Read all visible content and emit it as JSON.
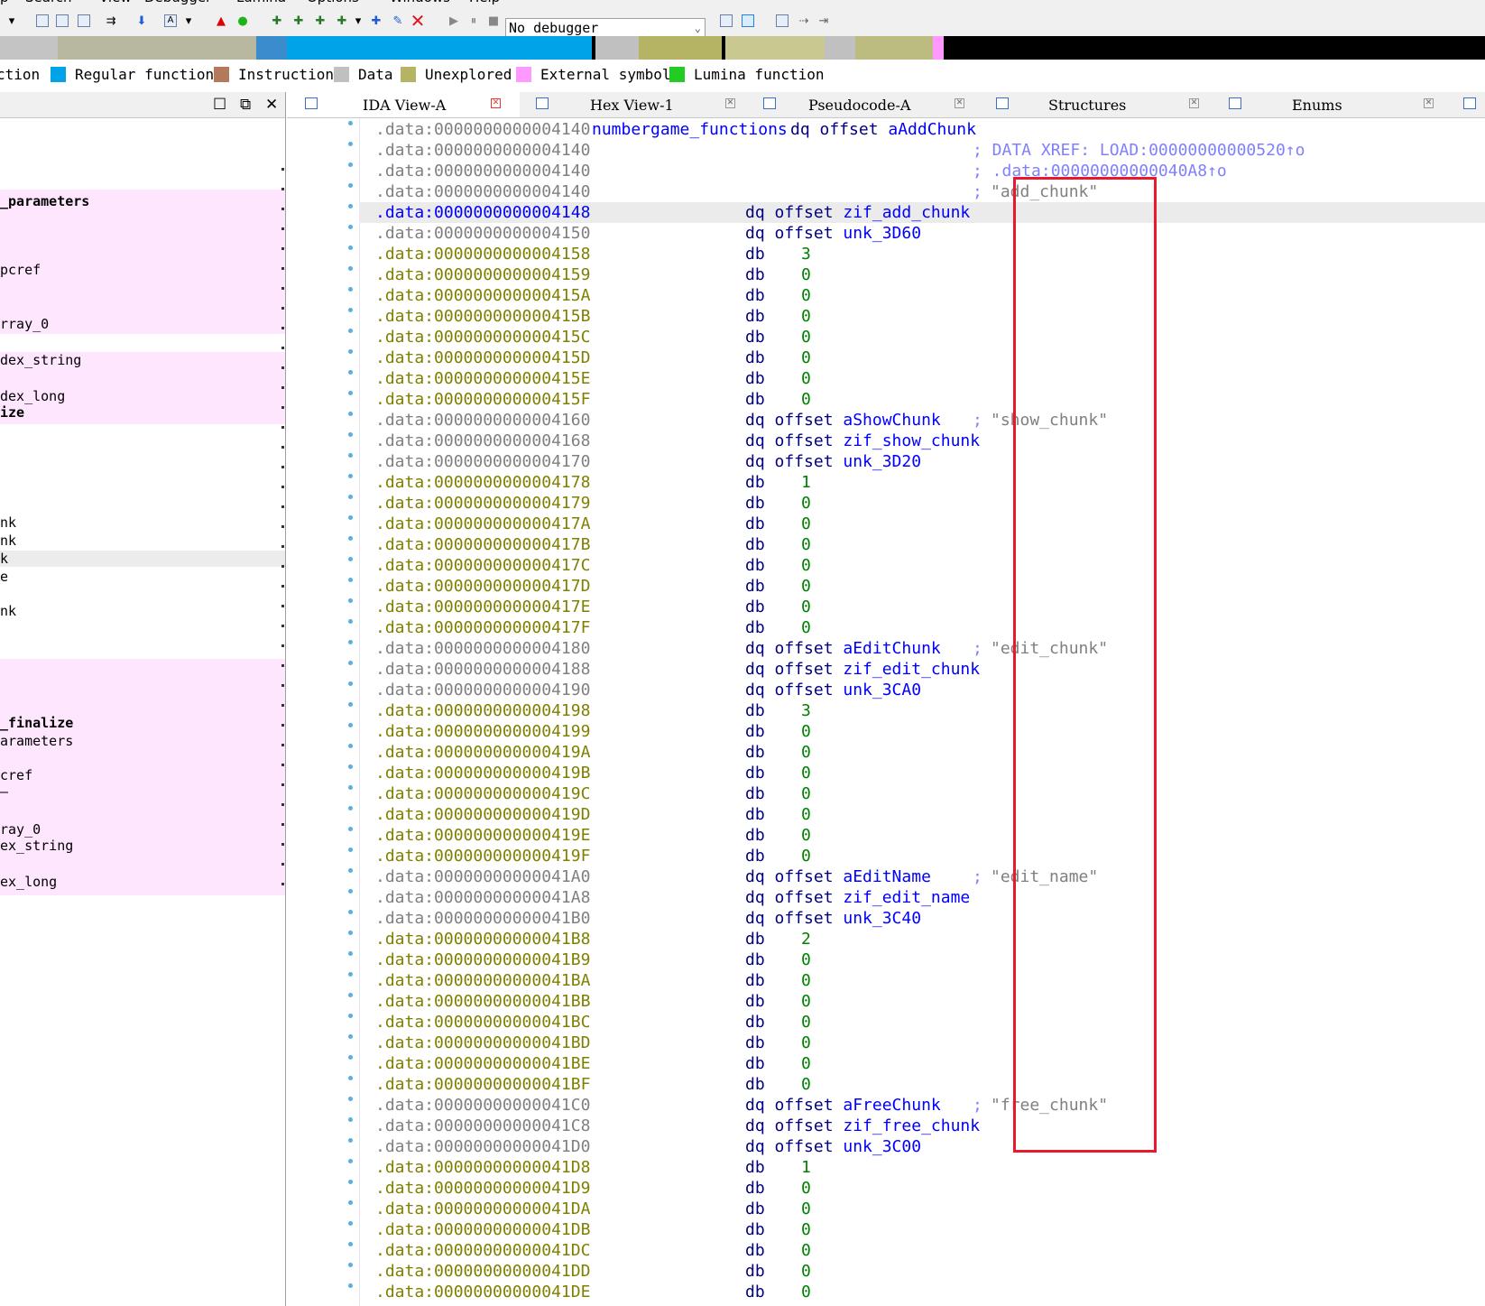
{
  "menu": [
    "p",
    "Search",
    "View",
    "Debugger",
    "Lumina",
    "Options",
    "Windows",
    "Help"
  ],
  "toolbar": {
    "debugger": "No debugger",
    "icons": [
      "dropdown-icon",
      "jump-icon",
      "jump-icon",
      "jump-icon",
      "forward-icon",
      "down-arrow-icon",
      "text-icon",
      "chart-icon",
      "green-dot-icon",
      "add-icon",
      "add-icon",
      "add-icon",
      "add-icon",
      "dropdown-icon",
      "add-icon",
      "edit-icon",
      "close-icon",
      "play-icon",
      "pause-icon",
      "stop-icon",
      "debugger-dropdown",
      "attach-icon",
      "step-icon",
      "graph-icon",
      "step-into-icon",
      "step-over-icon"
    ]
  },
  "legend": [
    {
      "label": "ction",
      "color": ""
    },
    {
      "label": "Regular function",
      "color": "#00a2e8"
    },
    {
      "label": "Instruction",
      "color": "#b4785a"
    },
    {
      "label": "Data",
      "color": "#c0c0c0"
    },
    {
      "label": "Unexplored",
      "color": "#b4b464"
    },
    {
      "label": "External symbol",
      "color": "#ff99ff"
    },
    {
      "label": "Lumina function",
      "color": "#22cc22"
    }
  ],
  "left_panel": {
    "items": [
      "_parameters",
      "pcref",
      "rray_0",
      "dex_string",
      "dex_long",
      "ize",
      "nk",
      "nk",
      "k",
      "e",
      "nk",
      "_finalize",
      "arameters",
      "cref",
      "—",
      "ray_0",
      "ex_string",
      "ex_long"
    ]
  },
  "tabs": [
    {
      "label": "IDA View-A",
      "active": true
    },
    {
      "label": "Hex View-1",
      "active": false
    },
    {
      "label": "Pseudocode-A",
      "active": false
    },
    {
      "label": "Structures",
      "active": false
    },
    {
      "label": "Enums",
      "active": false
    }
  ],
  "listing": [
    {
      "addr": ".data:0000000000004140",
      "c": "g",
      "label": "numbergame_functions",
      "op": "dq offset aAddChunk",
      "cmt": "",
      "str": ""
    },
    {
      "addr": ".data:0000000000004140",
      "c": "g",
      "label": "",
      "op": "",
      "cmt": "; DATA XREF: LOAD:00000000000520↑o",
      "str": ""
    },
    {
      "addr": ".data:0000000000004140",
      "c": "g",
      "label": "",
      "op": "",
      "cmt": "; .data:00000000000040A8↑o",
      "str": ""
    },
    {
      "addr": ".data:0000000000004140",
      "c": "g",
      "label": "",
      "op": "",
      "cmt": ";",
      "str": "\"add_chunk\""
    },
    {
      "addr": ".data:0000000000004148",
      "c": "b",
      "label": "",
      "op": "dq offset zif_add_chunk",
      "cmt": "",
      "str": ""
    },
    {
      "addr": ".data:0000000000004150",
      "c": "g",
      "label": "",
      "op": "dq offset unk_3D60",
      "cmt": "",
      "str": ""
    },
    {
      "addr": ".data:0000000000004158",
      "c": "y",
      "label": "",
      "op": "db",
      "val": "3"
    },
    {
      "addr": ".data:0000000000004159",
      "c": "y",
      "label": "",
      "op": "db",
      "val": "0"
    },
    {
      "addr": ".data:000000000000415A",
      "c": "y",
      "label": "",
      "op": "db",
      "val": "0"
    },
    {
      "addr": ".data:000000000000415B",
      "c": "y",
      "label": "",
      "op": "db",
      "val": "0"
    },
    {
      "addr": ".data:000000000000415C",
      "c": "y",
      "label": "",
      "op": "db",
      "val": "0"
    },
    {
      "addr": ".data:000000000000415D",
      "c": "y",
      "label": "",
      "op": "db",
      "val": "0"
    },
    {
      "addr": ".data:000000000000415E",
      "c": "y",
      "label": "",
      "op": "db",
      "val": "0"
    },
    {
      "addr": ".data:000000000000415F",
      "c": "y",
      "label": "",
      "op": "db",
      "val": "0"
    },
    {
      "addr": ".data:0000000000004160",
      "c": "g",
      "label": "",
      "op": "dq offset aShowChunk",
      "cmt": ";",
      "str": "\"show_chunk\""
    },
    {
      "addr": ".data:0000000000004168",
      "c": "g",
      "label": "",
      "op": "dq offset zif_show_chunk",
      "cmt": "",
      "str": ""
    },
    {
      "addr": ".data:0000000000004170",
      "c": "g",
      "label": "",
      "op": "dq offset unk_3D20",
      "cmt": "",
      "str": ""
    },
    {
      "addr": ".data:0000000000004178",
      "c": "y",
      "label": "",
      "op": "db",
      "val": "1"
    },
    {
      "addr": ".data:0000000000004179",
      "c": "y",
      "label": "",
      "op": "db",
      "val": "0"
    },
    {
      "addr": ".data:000000000000417A",
      "c": "y",
      "label": "",
      "op": "db",
      "val": "0"
    },
    {
      "addr": ".data:000000000000417B",
      "c": "y",
      "label": "",
      "op": "db",
      "val": "0"
    },
    {
      "addr": ".data:000000000000417C",
      "c": "y",
      "label": "",
      "op": "db",
      "val": "0"
    },
    {
      "addr": ".data:000000000000417D",
      "c": "y",
      "label": "",
      "op": "db",
      "val": "0"
    },
    {
      "addr": ".data:000000000000417E",
      "c": "y",
      "label": "",
      "op": "db",
      "val": "0"
    },
    {
      "addr": ".data:000000000000417F",
      "c": "y",
      "label": "",
      "op": "db",
      "val": "0"
    },
    {
      "addr": ".data:0000000000004180",
      "c": "g",
      "label": "",
      "op": "dq offset aEditChunk",
      "cmt": ";",
      "str": "\"edit_chunk\""
    },
    {
      "addr": ".data:0000000000004188",
      "c": "g",
      "label": "",
      "op": "dq offset zif_edit_chunk",
      "cmt": "",
      "str": ""
    },
    {
      "addr": ".data:0000000000004190",
      "c": "g",
      "label": "",
      "op": "dq offset unk_3CA0",
      "cmt": "",
      "str": ""
    },
    {
      "addr": ".data:0000000000004198",
      "c": "y",
      "label": "",
      "op": "db",
      "val": "3"
    },
    {
      "addr": ".data:0000000000004199",
      "c": "y",
      "label": "",
      "op": "db",
      "val": "0"
    },
    {
      "addr": ".data:000000000000419A",
      "c": "y",
      "label": "",
      "op": "db",
      "val": "0"
    },
    {
      "addr": ".data:000000000000419B",
      "c": "y",
      "label": "",
      "op": "db",
      "val": "0"
    },
    {
      "addr": ".data:000000000000419C",
      "c": "y",
      "label": "",
      "op": "db",
      "val": "0"
    },
    {
      "addr": ".data:000000000000419D",
      "c": "y",
      "label": "",
      "op": "db",
      "val": "0"
    },
    {
      "addr": ".data:000000000000419E",
      "c": "y",
      "label": "",
      "op": "db",
      "val": "0"
    },
    {
      "addr": ".data:000000000000419F",
      "c": "y",
      "label": "",
      "op": "db",
      "val": "0"
    },
    {
      "addr": ".data:00000000000041A0",
      "c": "g",
      "label": "",
      "op": "dq offset aEditName",
      "cmt": ";",
      "str": "\"edit_name\""
    },
    {
      "addr": ".data:00000000000041A8",
      "c": "g",
      "label": "",
      "op": "dq offset zif_edit_name",
      "cmt": "",
      "str": ""
    },
    {
      "addr": ".data:00000000000041B0",
      "c": "g",
      "label": "",
      "op": "dq offset unk_3C40",
      "cmt": "",
      "str": ""
    },
    {
      "addr": ".data:00000000000041B8",
      "c": "y",
      "label": "",
      "op": "db",
      "val": "2"
    },
    {
      "addr": ".data:00000000000041B9",
      "c": "y",
      "label": "",
      "op": "db",
      "val": "0"
    },
    {
      "addr": ".data:00000000000041BA",
      "c": "y",
      "label": "",
      "op": "db",
      "val": "0"
    },
    {
      "addr": ".data:00000000000041BB",
      "c": "y",
      "label": "",
      "op": "db",
      "val": "0"
    },
    {
      "addr": ".data:00000000000041BC",
      "c": "y",
      "label": "",
      "op": "db",
      "val": "0"
    },
    {
      "addr": ".data:00000000000041BD",
      "c": "y",
      "label": "",
      "op": "db",
      "val": "0"
    },
    {
      "addr": ".data:00000000000041BE",
      "c": "y",
      "label": "",
      "op": "db",
      "val": "0"
    },
    {
      "addr": ".data:00000000000041BF",
      "c": "y",
      "label": "",
      "op": "db",
      "val": "0"
    },
    {
      "addr": ".data:00000000000041C0",
      "c": "g",
      "label": "",
      "op": "dq offset aFreeChunk",
      "cmt": ";",
      "str": "\"free_chunk\""
    },
    {
      "addr": ".data:00000000000041C8",
      "c": "g",
      "label": "",
      "op": "dq offset zif_free_chunk",
      "cmt": "",
      "str": ""
    },
    {
      "addr": ".data:00000000000041D0",
      "c": "g",
      "label": "",
      "op": "dq offset unk_3C00",
      "cmt": "",
      "str": ""
    },
    {
      "addr": ".data:00000000000041D8",
      "c": "y",
      "label": "",
      "op": "db",
      "val": "1"
    },
    {
      "addr": ".data:00000000000041D9",
      "c": "y",
      "label": "",
      "op": "db",
      "val": "0"
    },
    {
      "addr": ".data:00000000000041DA",
      "c": "y",
      "label": "",
      "op": "db",
      "val": "0"
    },
    {
      "addr": ".data:00000000000041DB",
      "c": "y",
      "label": "",
      "op": "db",
      "val": "0"
    },
    {
      "addr": ".data:00000000000041DC",
      "c": "y",
      "label": "",
      "op": "db",
      "val": "0"
    },
    {
      "addr": ".data:00000000000041DD",
      "c": "y",
      "label": "",
      "op": "db",
      "val": "0"
    },
    {
      "addr": ".data:00000000000041DE",
      "c": "y",
      "label": "",
      "op": "db",
      "val": "0"
    }
  ]
}
